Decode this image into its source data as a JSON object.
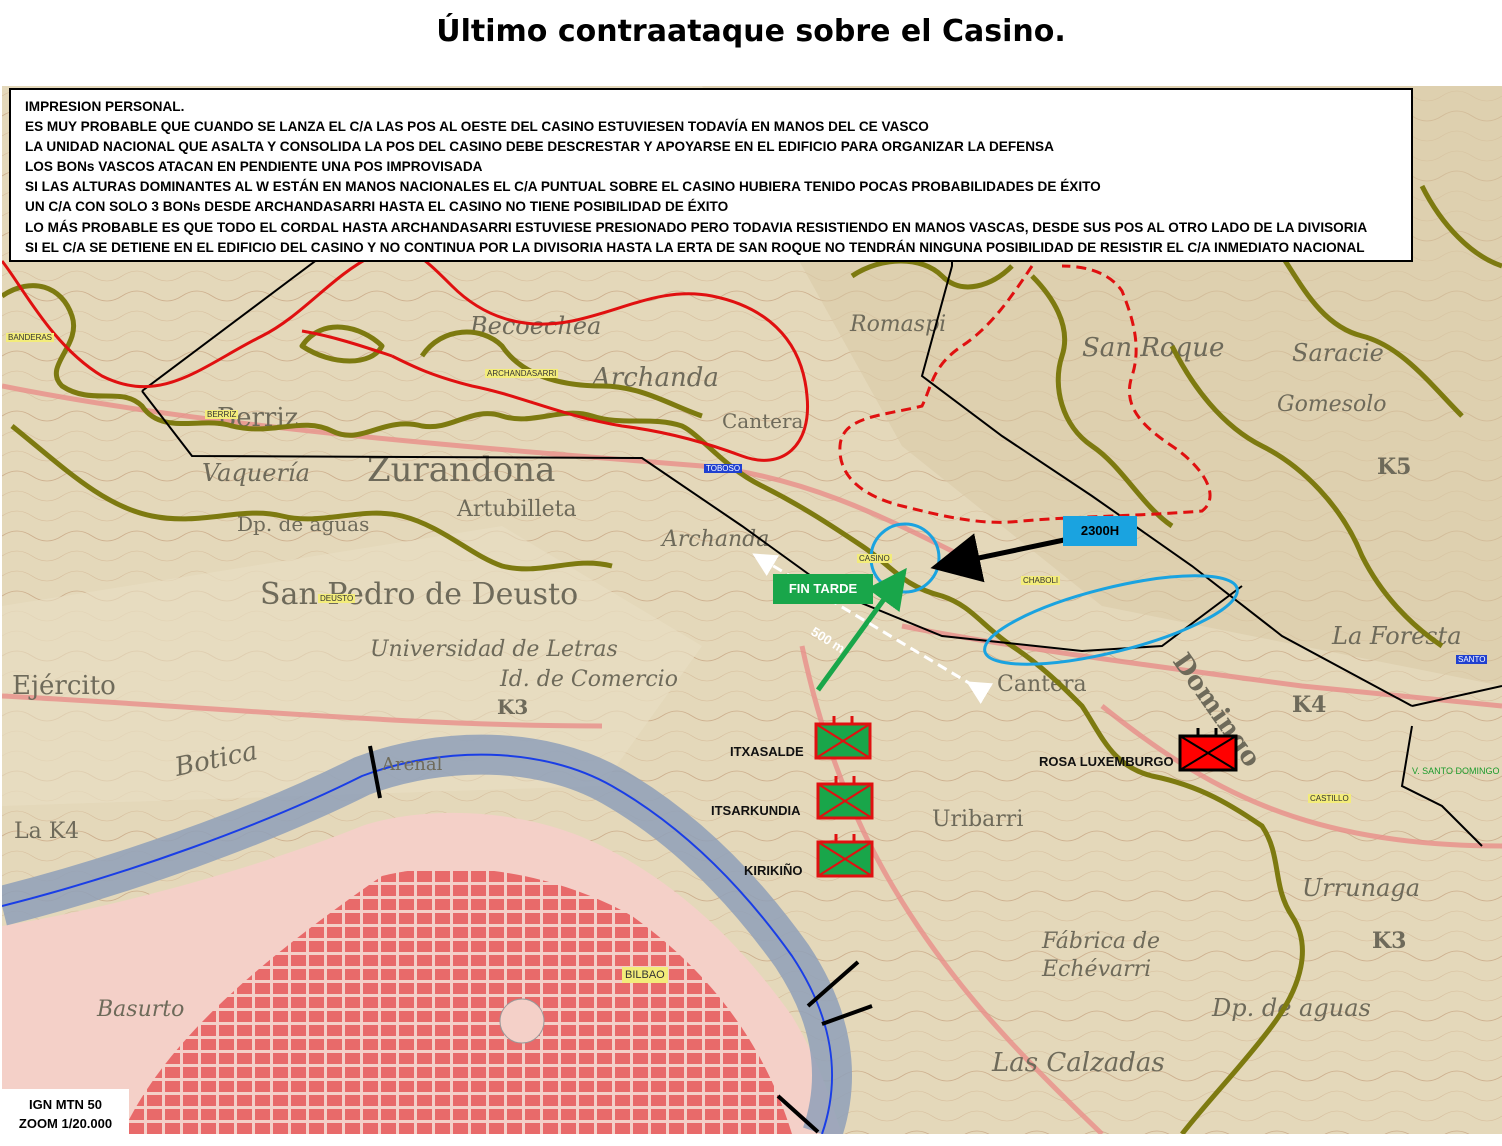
{
  "title": "Último contraataque sobre el Casino.",
  "notes": [
    "IMPRESION PERSONAL.",
    "ES MUY PROBABLE QUE CUANDO SE LANZA EL C/A LAS POS AL OESTE DEL CASINO ESTUVIESEN TODAVÍA EN MANOS DEL CE VASCO",
    "LA UNIDAD NACIONAL QUE ASALTA Y CONSOLIDA LA POS DEL CASINO DEBE DESCRESTAR Y APOYARSE EN EL EDIFICIO PARA ORGANIZAR LA DEFENSA",
    "LOS BONs VASCOS ATACAN EN PENDIENTE UNA POS IMPROVISADA",
    "SI LAS ALTURAS DOMINANTES AL W ESTÁN EN MANOS NACIONALES EL C/A PUNTUAL SOBRE EL CASINO HUBIERA TENIDO POCAS PROBABILIDADES DE ÉXITO",
    "UN C/A CON SOLO 3 BONs DESDE ARCHANDASARRI HASTA EL CASINO NO TIENE POSIBILIDAD DE ÉXITO",
    "LO MÁS PROBABLE ES QUE TODO EL CORDAL HASTA ARCHANDASARRI ESTUVIESE PRESIONADO PERO  TODAVIA RESISTIENDO EN MANOS VASCAS, DESDE SUS POS AL OTRO LADO DE LA DIVISORIA",
    "SI EL C/A SE DETIENE EN EL EDIFICIO DEL CASINO Y NO CONTINUA POR LA DIVISORIA HASTA LA ERTA DE SAN ROQUE NO TENDRÁN NINGUNA POSIBILIDAD DE RESISTIR EL C/A INMEDIATO NACIONAL"
  ],
  "scale": {
    "source": "IGN MTN 50",
    "zoom": "ZOOM 1/20.000"
  },
  "callouts": {
    "time_2300": "2300H",
    "fin_tarde": "FIN TARDE",
    "distance": "500 m"
  },
  "units": [
    {
      "name": "ITXASALDE",
      "side": "vasco",
      "color": "#19a64a"
    },
    {
      "name": "ITSARKUNDIA",
      "side": "vasco",
      "color": "#19a64a"
    },
    {
      "name": "KIRIKIÑO",
      "side": "vasco",
      "color": "#19a64a"
    },
    {
      "name": "ROSA LUXEMBURGO",
      "side": "vasco",
      "color": "#ff0000"
    }
  ],
  "place_tags": {
    "banderas": "BANDERAS",
    "berriz": "BERRIZ",
    "archandasarri": "ARCHANDASARRI",
    "casino": "CASINO",
    "chaboli": "CHABOLI",
    "deusto": "DEUSTO",
    "castillo": "CASTILLO",
    "bilbao": "BILBAO",
    "blue1": "TOBOSO",
    "blue2": "SANTO",
    "santo_domingo": "V. SANTO DOMINGO"
  },
  "map_names": {
    "san_pedro": "San Pedro de Deusto",
    "universidad": "Universidad de Letras",
    "comercio": "Id. de Comercio",
    "ejercito": "Ejército",
    "botica": "Botica",
    "zurandona": "Zurandona",
    "artubilleta": "Artubilleta",
    "berriz": "Berriz",
    "becoechea": "Becoechea",
    "archanda": "Archanda",
    "archanda2": "Archanda",
    "cantera": "Cantera",
    "cantera2": "Cantera",
    "san_roque": "San Roque",
    "saracie": "Saracie",
    "gomesolo": "Gomesolo",
    "foresta": "La Foresta",
    "uribarri": "Uribarri",
    "echevarri": "Echévarri",
    "fabrica": "Fábrica de",
    "urrunaga": "Urrunaga",
    "caizadas": "Las Calzadas",
    "agua": "Dp. de aguas",
    "basurto": "Basurto",
    "arenal": "Arenal",
    "la_k4": "La K4",
    "vaqueria": "Vaquería",
    "dp_aguas": "Dp. de aguas",
    "bentazar": "Romaspi",
    "k5": "K5",
    "k3a": "K3",
    "k3b": "K3",
    "k4": "K4",
    "domingo": "Domingo"
  },
  "colors": {
    "nacional_line": "#e01010",
    "ridge": "#7d7a10",
    "blue": "#1aa3e0",
    "river": "#1a3ee6",
    "arrow_green": "#19a64a"
  }
}
